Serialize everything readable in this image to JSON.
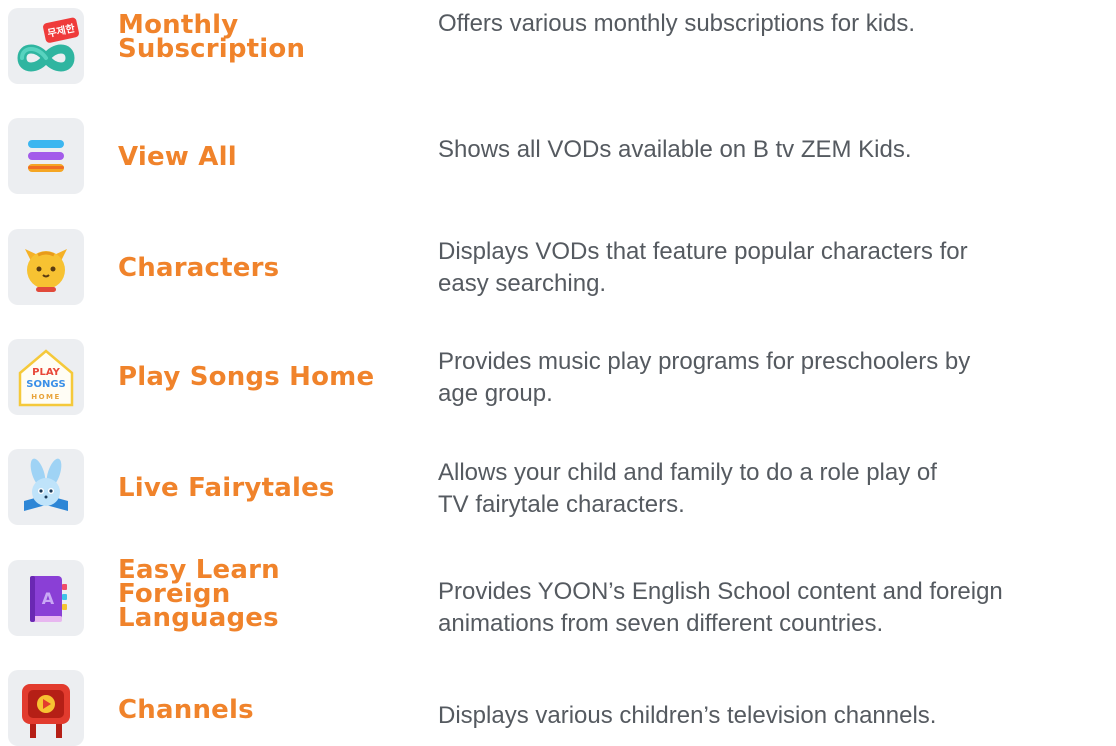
{
  "colors": {
    "title_orange": "#f0832b",
    "description_gray": "#555a60",
    "icon_tile_bg": "#eceef1"
  },
  "items": [
    {
      "icon": "monthly-subscription-icon",
      "badge_text": "무제한",
      "title_lines": [
        "Monthly",
        "Subscription"
      ],
      "desc_lines": [
        "Offers various monthly subscriptions for kids."
      ]
    },
    {
      "icon": "view-all-icon",
      "title_lines": [
        "View All"
      ],
      "desc_lines": [
        "Shows all VODs available on B tv ZEM Kids."
      ]
    },
    {
      "icon": "characters-icon",
      "title_lines": [
        "Characters"
      ],
      "desc_lines": [
        "Displays VODs that feature popular characters for",
        "easy searching."
      ]
    },
    {
      "icon": "play-songs-home-icon",
      "logo_text": [
        "PLAY",
        "SONGS",
        "HOME"
      ],
      "title_lines": [
        "Play Songs Home"
      ],
      "desc_lines": [
        "Provides music play programs for preschoolers by",
        "age group."
      ]
    },
    {
      "icon": "live-fairytales-icon",
      "title_lines": [
        "Live Fairytales"
      ],
      "desc_lines": [
        "Allows your child and family to do a role play of",
        "TV fairytale characters."
      ]
    },
    {
      "icon": "easy-learn-foreign-languages-icon",
      "book_letter": "A",
      "title_lines": [
        "Easy Learn",
        "Foreign",
        "Languages"
      ],
      "desc_lines": [
        "Provides YOON’s English School content and foreign",
        "animations from seven different countries."
      ]
    },
    {
      "icon": "channels-icon",
      "title_lines": [
        "Channels"
      ],
      "desc_lines": [
        "Displays various children’s television channels."
      ]
    }
  ]
}
